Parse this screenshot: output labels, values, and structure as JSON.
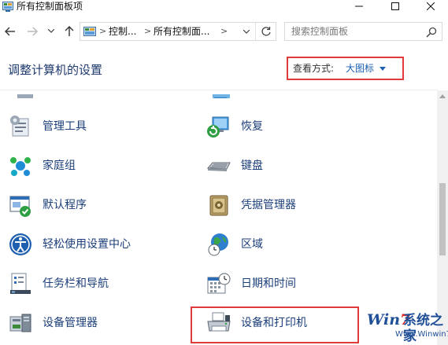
{
  "window": {
    "title": "所有控制面板项"
  },
  "address_bar": {
    "crumbs": [
      "控制...",
      "所有控制面..."
    ],
    "separator": ">"
  },
  "search": {
    "placeholder": "搜索控制面板"
  },
  "header": {
    "title": "调整计算机的设置",
    "view_by_label": "查看方式:",
    "view_by_value": "大图标"
  },
  "items": [
    {
      "label": "管理工具",
      "icon": "admin-tools-icon"
    },
    {
      "label": "恢复",
      "icon": "recovery-icon"
    },
    {
      "label": "家庭组",
      "icon": "homegroup-icon"
    },
    {
      "label": "键盘",
      "icon": "keyboard-icon"
    },
    {
      "label": "默认程序",
      "icon": "default-programs-icon"
    },
    {
      "label": "凭据管理器",
      "icon": "credential-manager-icon"
    },
    {
      "label": "轻松使用设置中心",
      "icon": "ease-of-access-icon"
    },
    {
      "label": "区域",
      "icon": "region-icon"
    },
    {
      "label": "任务栏和导航",
      "icon": "taskbar-icon"
    },
    {
      "label": "日期和时间",
      "icon": "date-time-icon"
    },
    {
      "label": "设备管理器",
      "icon": "device-manager-icon"
    },
    {
      "label": "设备和打印机",
      "icon": "devices-printers-icon"
    }
  ],
  "watermark": {
    "brand_prefix": "Win",
    "brand_digit": "7",
    "brand_cn": "系统之家",
    "url": "Www.Winwin7.com"
  },
  "colors": {
    "link": "#1c3f7a",
    "accent": "#1a5fb4",
    "highlight": "#e03a3a"
  }
}
